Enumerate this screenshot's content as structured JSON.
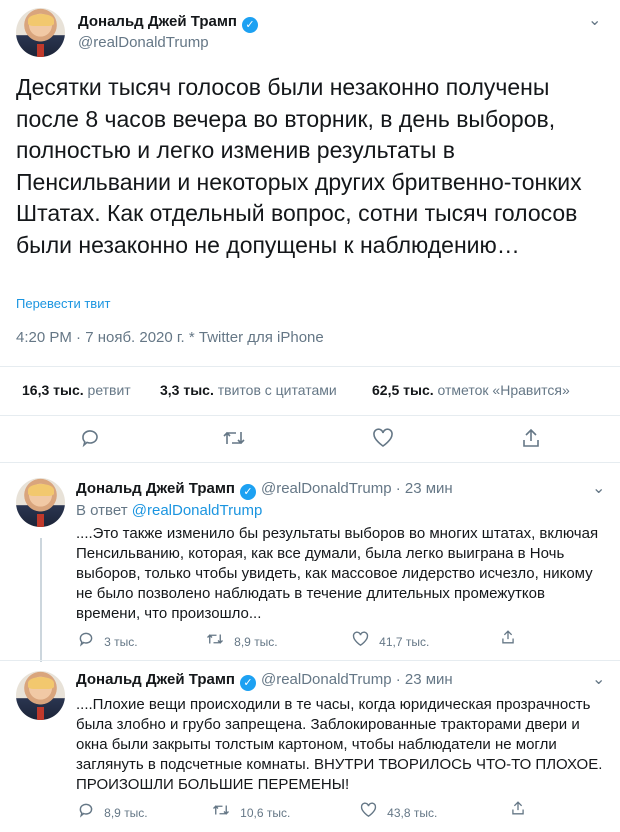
{
  "main": {
    "author_name": "Дональд Джей Трамп",
    "verified_mark": "✓",
    "handle": "@realDonaldTrump",
    "text": "Десятки тысяч голосов были незаконно получены после 8 часов вечера во вторник, в день выборов, полностью и легко изменив результаты в Пенсильвании и некоторых других бритвенно-тонких Штатах. Как отдельный вопрос, сотни тысяч голосов были незаконно не допущены к наблюдению…",
    "translate_label": "Перевести твит",
    "meta": "4:20 PM · 7 нояб. 2020 г. * Twitter для iPhone",
    "stats": {
      "retweets_count": "16,3 тыс.",
      "retweets_label": "ретвит",
      "quotes_count": "3,3 тыс.",
      "quotes_label": "твитов с цитатами",
      "likes_count": "62,5 тыс.",
      "likes_label": "отметок «Нравится»"
    },
    "icons": [
      "reply-icon",
      "retweet-icon",
      "like-icon",
      "share-icon"
    ]
  },
  "replies": [
    {
      "author_name": "Дональд Джей Трамп",
      "handle_time": "@realDonaldTrump · 23 мин",
      "in_reply_prefix": "В ответ",
      "in_reply_handle": "@realDonaldTrump",
      "text": "....Это также изменило бы результаты выборов во многих штатах, включая Пенсильванию, которая, как все думали, была легко выиграна в Ночь выборов, только чтобы увидеть, как массовое лидерство исчезло, никому не было позволено наблюдать в течение длительных промежутков времени, что произошло...",
      "replies_count": "3 тыс.",
      "retweets_count": "8,9 тыс.",
      "likes_count": "41,7 тыс."
    },
    {
      "author_name": "Дональд Джей Трамп",
      "handle_time": "@realDonaldTrump · 23 мин",
      "text": "....Плохие вещи происходили в те часы, когда юридическая прозрачность была злобно и грубо запрещена. Заблокированные тракторами двери и окна были закрыты толстым картоном, чтобы наблюдатели не могли заглянуть в подсчетные комнаты. ВНУТРИ ТВОРИЛОСЬ ЧТО-ТО ПЛОХОЕ. ПРОИЗОШЛИ БОЛЬШИЕ ПЕРЕМЕНЫ!",
      "replies_count": "8,9 тыс.",
      "retweets_count": "10,6 тыс.",
      "likes_count": "43,8 тыс."
    }
  ]
}
